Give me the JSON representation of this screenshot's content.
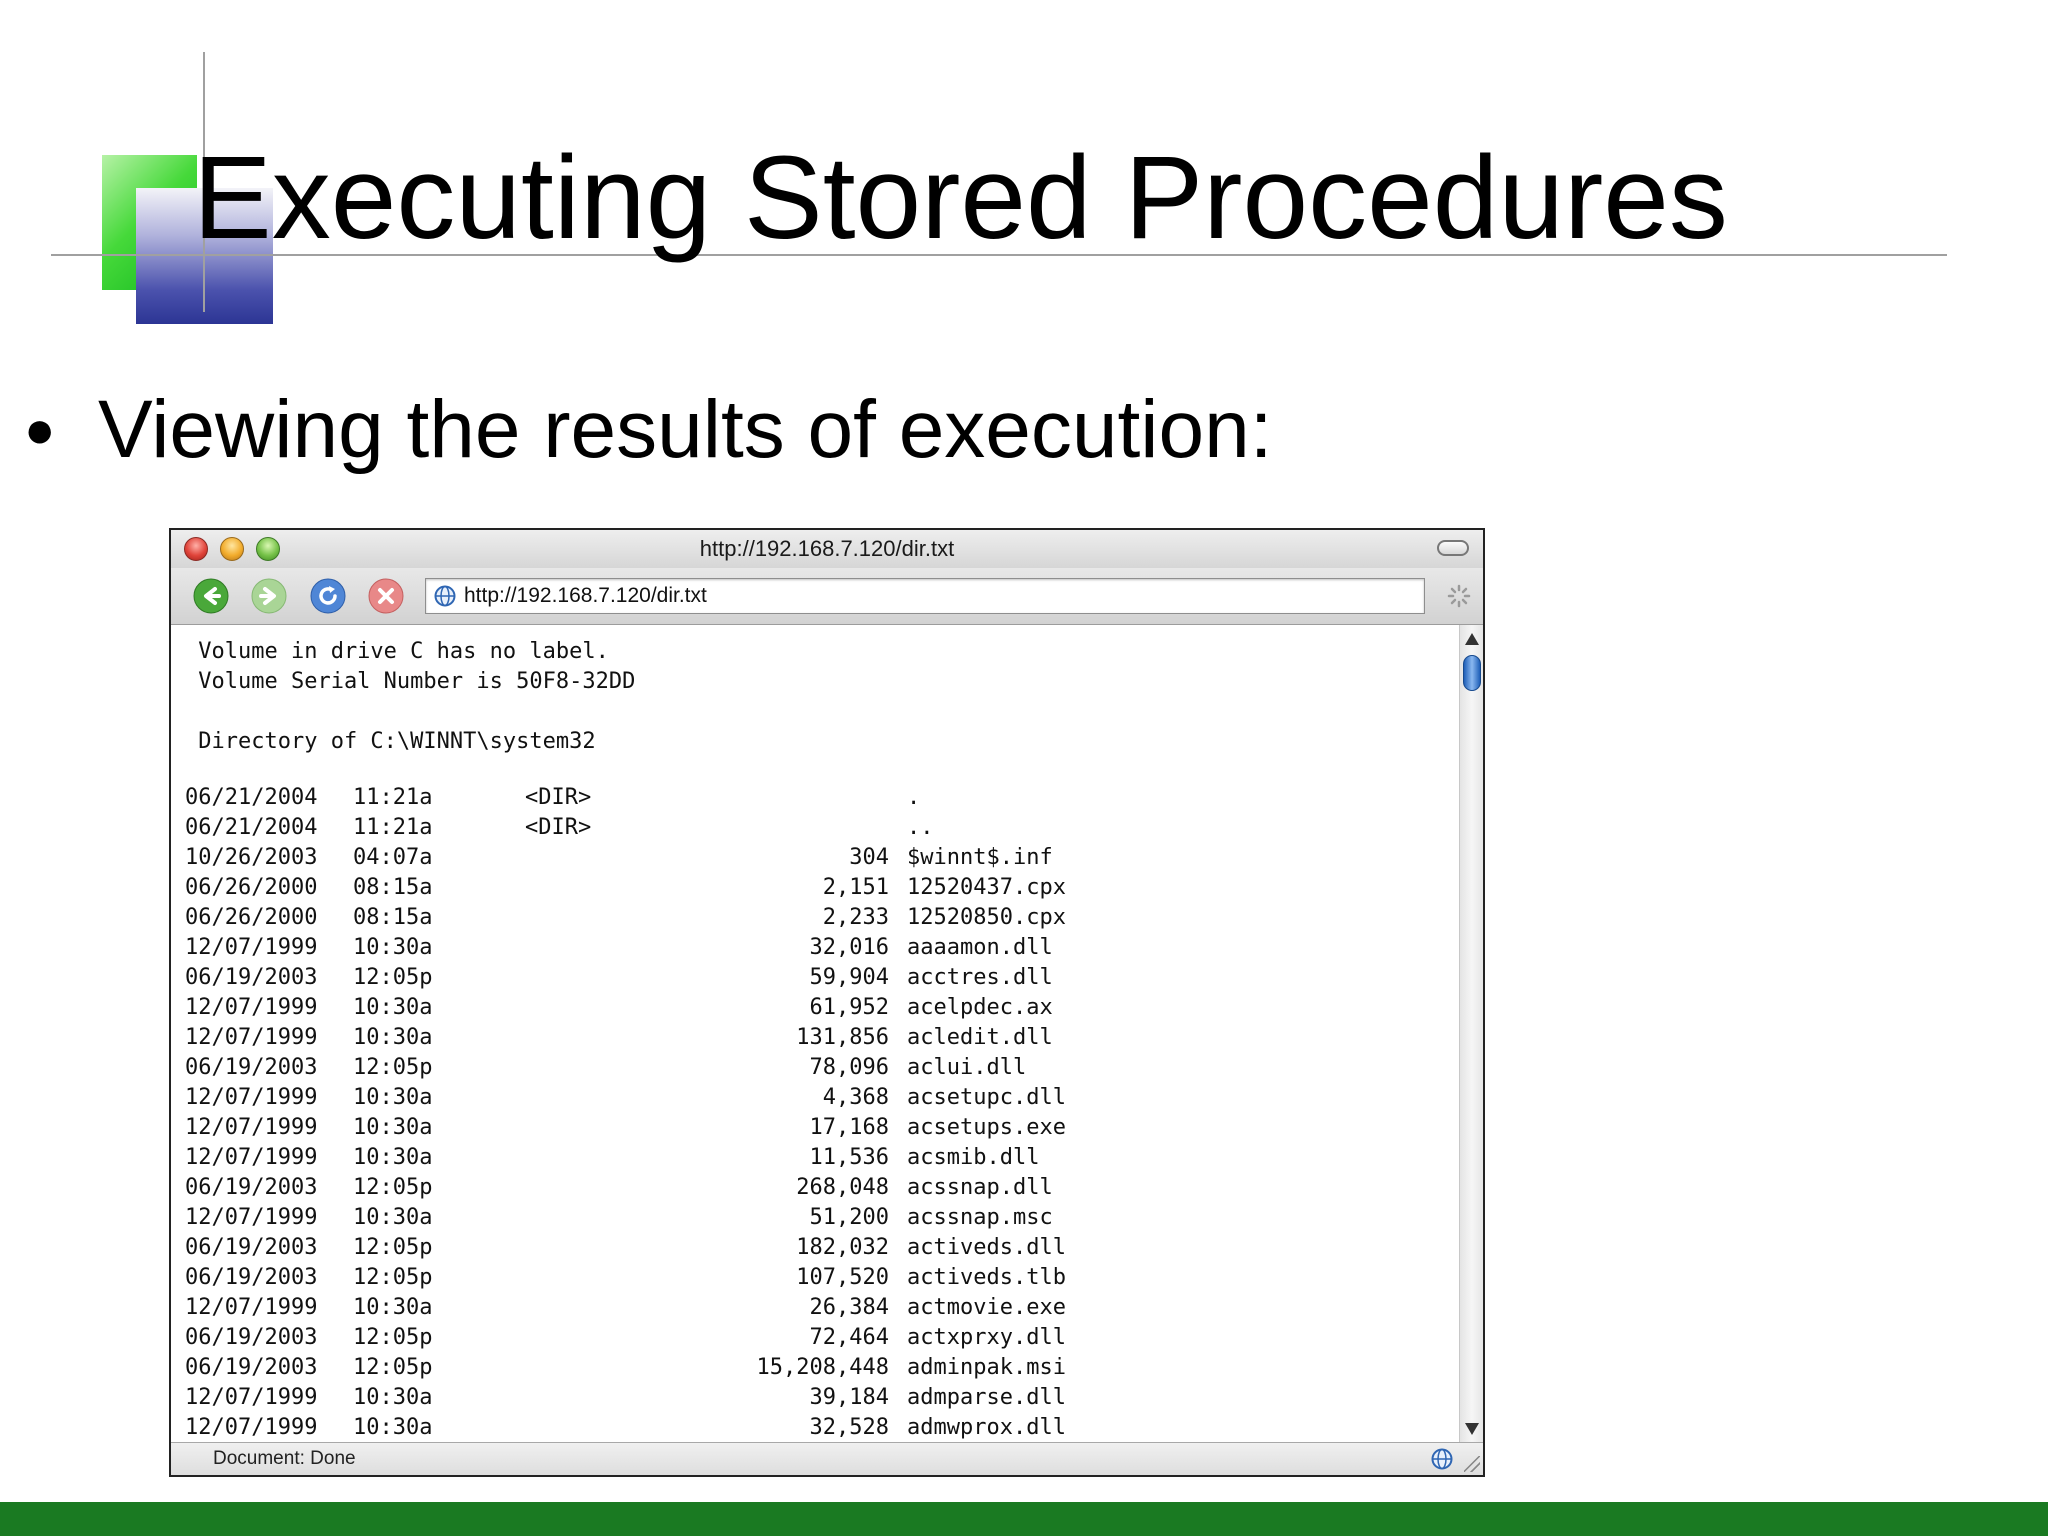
{
  "slide": {
    "title": "Executing Stored Procedures",
    "bullet": "Viewing the results of execution:"
  },
  "browser": {
    "window_title": "http://192.168.7.120/dir.txt",
    "url": "http://192.168.7.120/dir.txt",
    "status": "Document: Done",
    "icons": [
      "back-icon",
      "forward-icon",
      "reload-icon",
      "stop-icon",
      "globe-icon",
      "spinner-icon"
    ]
  },
  "listing": {
    "header_lines": [
      " Volume in drive C has no label.",
      " Volume Serial Number is 50F8-32DD",
      "",
      " Directory of C:\\WINNT\\system32"
    ],
    "rows": [
      {
        "date": "06/21/2004",
        "time": "11:21a",
        "dir": "<DIR>",
        "size": "",
        "name": "."
      },
      {
        "date": "06/21/2004",
        "time": "11:21a",
        "dir": "<DIR>",
        "size": "",
        "name": ".."
      },
      {
        "date": "10/26/2003",
        "time": "04:07a",
        "dir": "",
        "size": "304",
        "name": "$winnt$.inf"
      },
      {
        "date": "06/26/2000",
        "time": "08:15a",
        "dir": "",
        "size": "2,151",
        "name": "12520437.cpx"
      },
      {
        "date": "06/26/2000",
        "time": "08:15a",
        "dir": "",
        "size": "2,233",
        "name": "12520850.cpx"
      },
      {
        "date": "12/07/1999",
        "time": "10:30a",
        "dir": "",
        "size": "32,016",
        "name": "aaaamon.dll"
      },
      {
        "date": "06/19/2003",
        "time": "12:05p",
        "dir": "",
        "size": "59,904",
        "name": "acctres.dll"
      },
      {
        "date": "12/07/1999",
        "time": "10:30a",
        "dir": "",
        "size": "61,952",
        "name": "acelpdec.ax"
      },
      {
        "date": "12/07/1999",
        "time": "10:30a",
        "dir": "",
        "size": "131,856",
        "name": "acledit.dll"
      },
      {
        "date": "06/19/2003",
        "time": "12:05p",
        "dir": "",
        "size": "78,096",
        "name": "aclui.dll"
      },
      {
        "date": "12/07/1999",
        "time": "10:30a",
        "dir": "",
        "size": "4,368",
        "name": "acsetupc.dll"
      },
      {
        "date": "12/07/1999",
        "time": "10:30a",
        "dir": "",
        "size": "17,168",
        "name": "acsetups.exe"
      },
      {
        "date": "12/07/1999",
        "time": "10:30a",
        "dir": "",
        "size": "11,536",
        "name": "acsmib.dll"
      },
      {
        "date": "06/19/2003",
        "time": "12:05p",
        "dir": "",
        "size": "268,048",
        "name": "acssnap.dll"
      },
      {
        "date": "12/07/1999",
        "time": "10:30a",
        "dir": "",
        "size": "51,200",
        "name": "acssnap.msc"
      },
      {
        "date": "06/19/2003",
        "time": "12:05p",
        "dir": "",
        "size": "182,032",
        "name": "activeds.dll"
      },
      {
        "date": "06/19/2003",
        "time": "12:05p",
        "dir": "",
        "size": "107,520",
        "name": "activeds.tlb"
      },
      {
        "date": "12/07/1999",
        "time": "10:30a",
        "dir": "",
        "size": "26,384",
        "name": "actmovie.exe"
      },
      {
        "date": "06/19/2003",
        "time": "12:05p",
        "dir": "",
        "size": "72,464",
        "name": "actxprxy.dll"
      },
      {
        "date": "06/19/2003",
        "time": "12:05p",
        "dir": "",
        "size": "15,208,448",
        "name": "adminpak.msi"
      },
      {
        "date": "12/07/1999",
        "time": "10:30a",
        "dir": "",
        "size": "39,184",
        "name": "admparse.dll"
      },
      {
        "date": "12/07/1999",
        "time": "10:30a",
        "dir": "",
        "size": "32,528",
        "name": "admwprox.dll"
      }
    ]
  },
  "colors": {
    "bottom_bar": "#1a7a22",
    "accent_green": "#46d93a",
    "accent_blue": "#2c3594"
  }
}
